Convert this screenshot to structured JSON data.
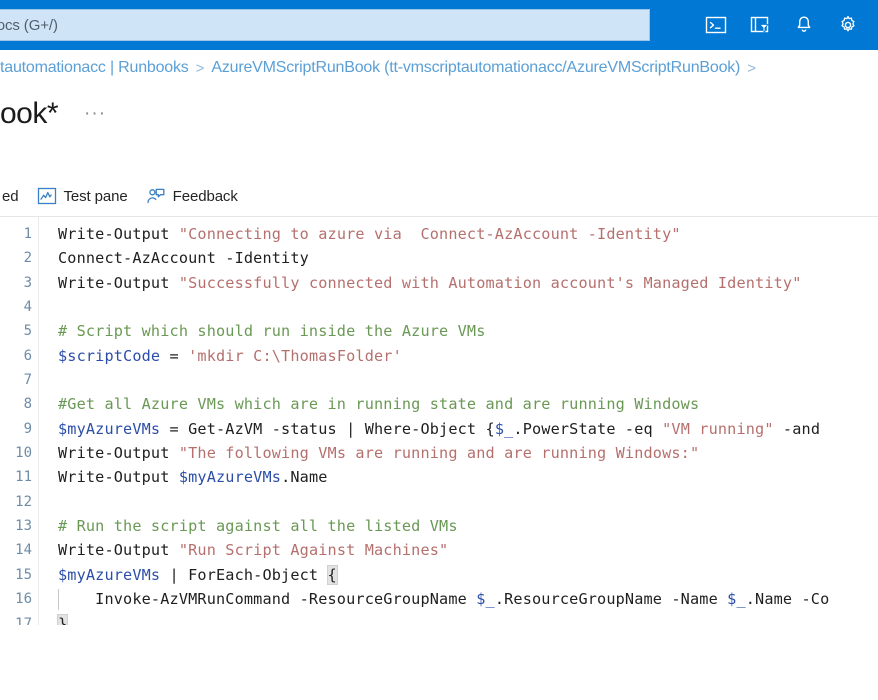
{
  "header": {
    "search": {
      "visible_text": "urces, services, and docs (G+/)",
      "placeholder": "Search resources, services, and docs (G+/)"
    },
    "icons": [
      {
        "name": "cloud-shell-icon",
        "label": "Cloud Shell"
      },
      {
        "name": "directories-subscriptions-icon",
        "label": "Directories + subscriptions"
      },
      {
        "name": "notifications-bell-icon",
        "label": "Notifications"
      },
      {
        "name": "settings-gear-icon",
        "label": "Settings"
      }
    ],
    "brand_color": "#0078d4"
  },
  "breadcrumb": {
    "items": [
      {
        "label": "tautomationacc | Runbooks",
        "separator": ">"
      },
      {
        "label": "AzureVMScriptRunBook (tt-vmscriptautomationacc/AzureVMScriptRunBook)",
        "separator": ">"
      }
    ],
    "link_color": "#5b9fd6"
  },
  "page": {
    "title": "ook*",
    "more_menu": "···"
  },
  "toolbar": {
    "items": [
      {
        "name": "revert-to-published-button",
        "label": "ed",
        "icon": "none"
      },
      {
        "name": "test-pane-button",
        "label": "Test pane",
        "icon": "test-pane-icon"
      },
      {
        "name": "feedback-button",
        "label": "Feedback",
        "icon": "feedback-icon"
      }
    ]
  },
  "editor": {
    "language": "PowerShell",
    "total_lines": 17,
    "colors": {
      "string": "#b5706e",
      "comment": "#6a9955",
      "variable": "#2b4ea8",
      "plain": "#1f1f1f",
      "line_number": "#6e8ca8"
    },
    "lines": [
      {
        "n": 1,
        "tokens": [
          {
            "t": "Write-Output ",
            "c": "plain"
          },
          {
            "t": "\"Connecting to azure via  Connect-AzAccount -Identity\"",
            "c": "string"
          }
        ]
      },
      {
        "n": 2,
        "tokens": [
          {
            "t": "Connect-AzAccount -Identity",
            "c": "plain"
          }
        ]
      },
      {
        "n": 3,
        "tokens": [
          {
            "t": "Write-Output ",
            "c": "plain"
          },
          {
            "t": "\"Successfully connected with Automation account's Managed Identity\"",
            "c": "string"
          }
        ]
      },
      {
        "n": 4,
        "tokens": []
      },
      {
        "n": 5,
        "tokens": [
          {
            "t": "# Script which should run inside the Azure VMs",
            "c": "comment"
          }
        ]
      },
      {
        "n": 6,
        "tokens": [
          {
            "t": "$scriptCode",
            "c": "var"
          },
          {
            "t": " = ",
            "c": "plain"
          },
          {
            "t": "'mkdir C:\\ThomasFolder'",
            "c": "string"
          }
        ]
      },
      {
        "n": 7,
        "tokens": []
      },
      {
        "n": 8,
        "tokens": [
          {
            "t": "#Get all Azure VMs which are in running state and are running Windows",
            "c": "comment"
          }
        ]
      },
      {
        "n": 9,
        "tokens": [
          {
            "t": "$myAzureVMs",
            "c": "var"
          },
          {
            "t": " = Get-AzVM -status | Where-Object {",
            "c": "plain"
          },
          {
            "t": "$_",
            "c": "var"
          },
          {
            "t": ".PowerState -eq ",
            "c": "plain"
          },
          {
            "t": "\"VM running\"",
            "c": "string"
          },
          {
            "t": " -and",
            "c": "plain"
          }
        ]
      },
      {
        "n": 10,
        "tokens": [
          {
            "t": "Write-Output ",
            "c": "plain"
          },
          {
            "t": "\"The following VMs are running and are running Windows:\"",
            "c": "string"
          }
        ]
      },
      {
        "n": 11,
        "tokens": [
          {
            "t": "Write-Output ",
            "c": "plain"
          },
          {
            "t": "$myAzureVMs",
            "c": "var"
          },
          {
            "t": ".Name",
            "c": "plain"
          }
        ]
      },
      {
        "n": 12,
        "tokens": []
      },
      {
        "n": 13,
        "tokens": [
          {
            "t": "# Run the script against all the listed VMs",
            "c": "comment"
          }
        ]
      },
      {
        "n": 14,
        "tokens": [
          {
            "t": "Write-Output ",
            "c": "plain"
          },
          {
            "t": "\"Run Script Against Machines\"",
            "c": "string"
          }
        ]
      },
      {
        "n": 15,
        "tokens": [
          {
            "t": "$myAzureVMs",
            "c": "var"
          },
          {
            "t": " | ForEach-Object ",
            "c": "plain"
          },
          {
            "t": "{",
            "c": "plain",
            "bracket": true
          }
        ]
      },
      {
        "n": 16,
        "indent_guide": true,
        "tokens": [
          {
            "t": "    Invoke-AzVMRunCommand -ResourceGroupName ",
            "c": "plain"
          },
          {
            "t": "$_",
            "c": "var"
          },
          {
            "t": ".ResourceGroupName -Name ",
            "c": "plain"
          },
          {
            "t": "$_",
            "c": "var"
          },
          {
            "t": ".Name -Co",
            "c": "plain"
          }
        ]
      },
      {
        "n": 17,
        "tokens": [
          {
            "t": "}",
            "c": "plain",
            "bracket": true
          }
        ]
      }
    ]
  }
}
